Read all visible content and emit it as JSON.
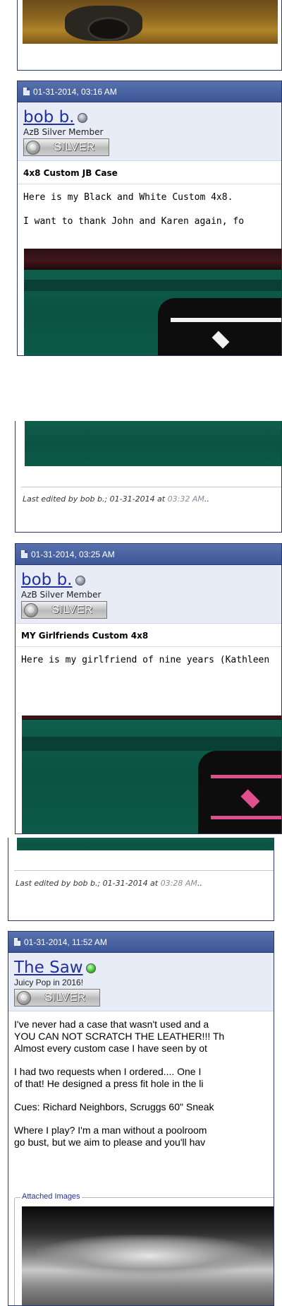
{
  "posts": [
    {
      "date": "01-31-2014, 03:16 AM",
      "username": "bob b.",
      "user_title": "AzB Silver Member",
      "badge": "SILVER",
      "title": "4x8 Custom JB Case",
      "lines": [
        "Here is my Black and White Custom 4x8.",
        "I want to thank John and Karen again, fo"
      ],
      "edit_note": {
        "prefix": "Last edited by bob b.; 01-31-2014 at ",
        "time": "03:32 AM",
        "suffix": ".."
      }
    },
    {
      "date": "01-31-2014, 03:25 AM",
      "username": "bob b.",
      "user_title": "AzB Silver Member",
      "badge": "SILVER",
      "title": "MY Girlfriends Custom 4x8",
      "lines": [
        "Here is my girlfriend of nine years (Kathleen"
      ],
      "edit_note": {
        "prefix": "Last edited by bob b.; 01-31-2014 at ",
        "time": "03:28 AM",
        "suffix": ".."
      }
    },
    {
      "date": "01-31-2014, 11:52 AM",
      "username": "The Saw",
      "user_title": "Juicy Pop in 2016!",
      "badge": "SILVER",
      "paragraphs": [
        [
          "I've never had a case that wasn't used and a",
          "YOU CAN NOT SCRATCH THE LEATHER!!! Th",
          "Almost every custom case I have seen by ot"
        ],
        [
          "I had two requests when I ordered.... One I",
          "of that! He designed a press fit hole in the li"
        ],
        [
          "Cues: Richard Neighbors, Scruggs 60\" Sneak"
        ],
        [
          "Where I play? I'm a man without a poolroom",
          "go bust, but we aim to please and you'll hav"
        ]
      ],
      "attachments_legend": "Attached Images"
    }
  ],
  "colors": {
    "header_blue": "#3d5695",
    "username_blue": "#22309a",
    "userinfo_bg": "#e8ecf6",
    "felt_green": "#0b5343",
    "pink_stripe": "#e0508f",
    "online_green": "#35c22e"
  },
  "icons": [
    "post-doc-icon",
    "offline-status-icon",
    "online-status-icon",
    "silver-badge-icon"
  ]
}
